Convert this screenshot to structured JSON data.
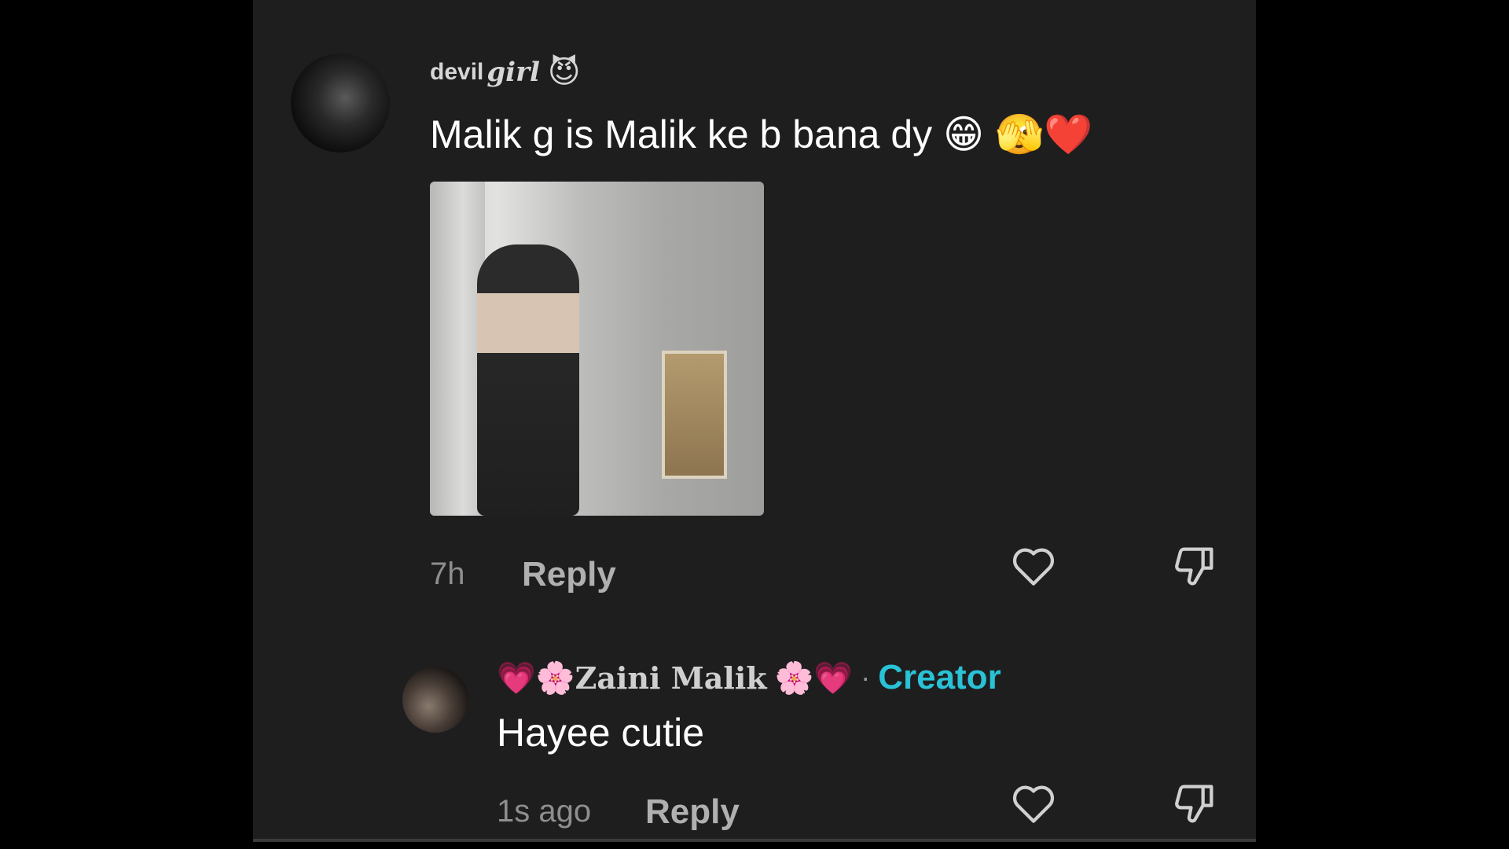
{
  "comment": {
    "username_prefix": "devil",
    "username_main": "girl",
    "username_emoji": "😈",
    "text": "Malik g is Malik ke b bana dy 😁 🫣❤️",
    "time": "7h",
    "reply_label": "Reply",
    "like_icon": "heart-outline",
    "dislike_icon": "thumbs-down-outline"
  },
  "reply": {
    "name_emoji_left": "💗🌸",
    "name": "Zaini Malik",
    "name_emoji_right": "🌸💗",
    "separator": "·",
    "badge": "Creator",
    "text": "Hayee cutie",
    "time": "1s ago",
    "reply_label": "Reply",
    "like_icon": "heart-outline",
    "dislike_icon": "thumbs-down-outline"
  },
  "colors": {
    "panel_bg": "#1e1e1e",
    "creator_badge": "#29c2d6",
    "meta_text": "#8e8e8e"
  }
}
